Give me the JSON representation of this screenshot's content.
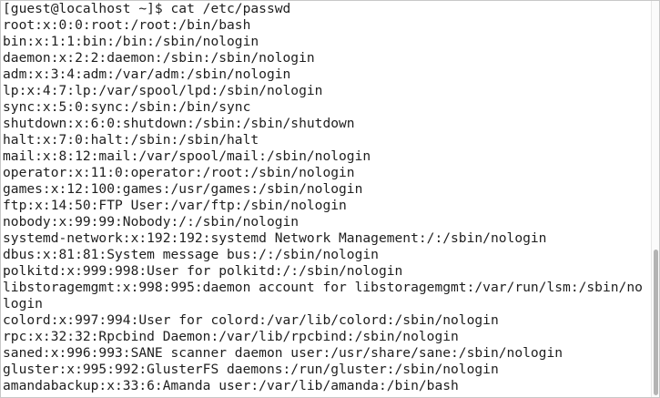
{
  "terminal": {
    "prompt": "[guest@localhost ~]$ cat /etc/passwd",
    "lines": [
      "root:x:0:0:root:/root:/bin/bash",
      "bin:x:1:1:bin:/bin:/sbin/nologin",
      "daemon:x:2:2:daemon:/sbin:/sbin/nologin",
      "adm:x:3:4:adm:/var/adm:/sbin/nologin",
      "lp:x:4:7:lp:/var/spool/lpd:/sbin/nologin",
      "sync:x:5:0:sync:/sbin:/bin/sync",
      "shutdown:x:6:0:shutdown:/sbin:/sbin/shutdown",
      "halt:x:7:0:halt:/sbin:/sbin/halt",
      "mail:x:8:12:mail:/var/spool/mail:/sbin/nologin",
      "operator:x:11:0:operator:/root:/sbin/nologin",
      "games:x:12:100:games:/usr/games:/sbin/nologin",
      "ftp:x:14:50:FTP User:/var/ftp:/sbin/nologin",
      "nobody:x:99:99:Nobody:/:/sbin/nologin",
      "systemd-network:x:192:192:systemd Network Management:/:/sbin/nologin",
      "dbus:x:81:81:System message bus:/:/sbin/nologin",
      "polkitd:x:999:998:User for polkitd:/:/sbin/nologin",
      "libstoragemgmt:x:998:995:daemon account for libstoragemgmt:/var/run/lsm:/sbin/no",
      "login",
      "colord:x:997:994:User for colord:/var/lib/colord:/sbin/nologin",
      "rpc:x:32:32:Rpcbind Daemon:/var/lib/rpcbind:/sbin/nologin",
      "saned:x:996:993:SANE scanner daemon user:/usr/share/sane:/sbin/nologin",
      "gluster:x:995:992:GlusterFS daemons:/run/gluster:/sbin/nologin",
      "amandabackup:x:33:6:Amanda user:/var/lib/amanda:/bin/bash"
    ]
  }
}
